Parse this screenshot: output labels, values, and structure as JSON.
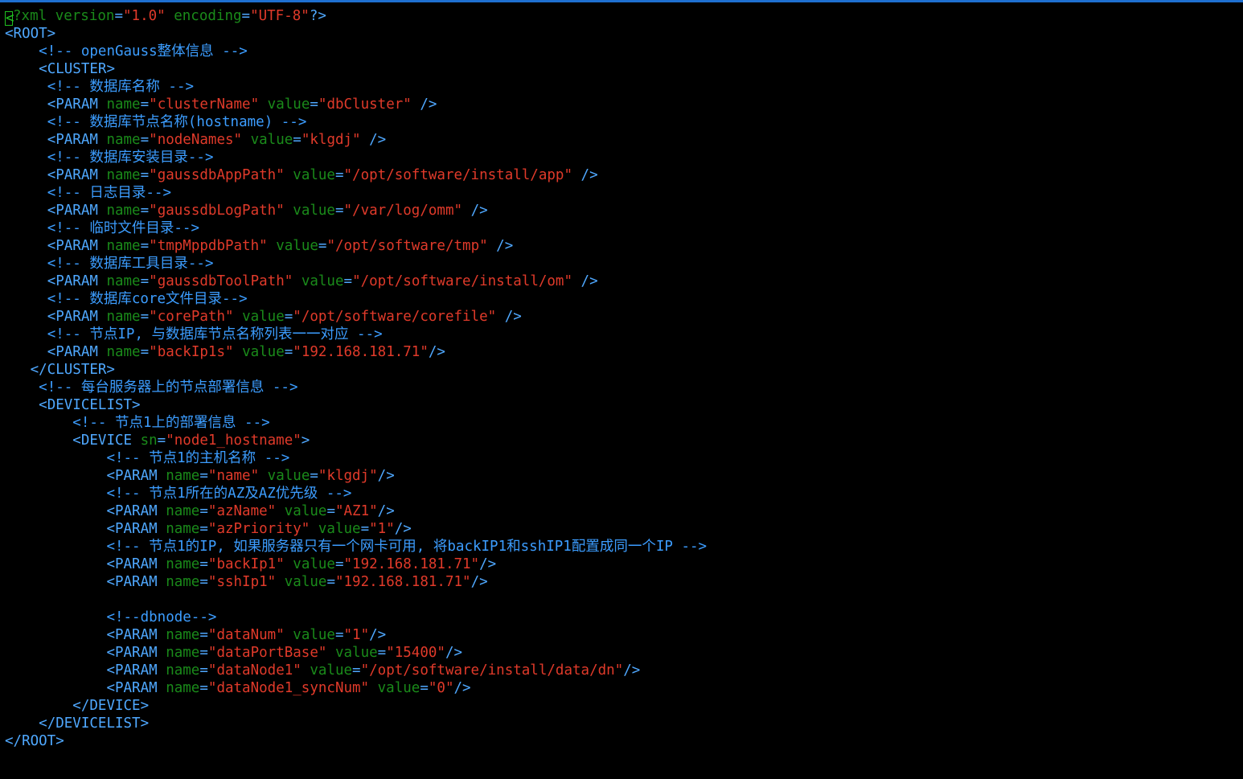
{
  "lines": [
    {
      "indent": "",
      "type": "pi"
    },
    {
      "indent": "",
      "type": "tag",
      "text": "<ROOT>"
    },
    {
      "indent": "    ",
      "type": "comment",
      "text": "<!-- openGauss整体信息 -->"
    },
    {
      "indent": "    ",
      "type": "tag",
      "text": "<CLUSTER>"
    },
    {
      "indent": "     ",
      "type": "comment",
      "text": "<!-- 数据库名称 -->"
    },
    {
      "indent": "     ",
      "type": "param",
      "name": "clusterName",
      "value": "dbCluster",
      "sep": " ",
      "close": " />"
    },
    {
      "indent": "     ",
      "type": "comment",
      "text": "<!-- 数据库节点名称(hostname) -->"
    },
    {
      "indent": "     ",
      "type": "param",
      "name": "nodeNames",
      "value": "klgdj",
      "sep": " ",
      "close": " />"
    },
    {
      "indent": "     ",
      "type": "comment",
      "text": "<!-- 数据库安装目录-->"
    },
    {
      "indent": "     ",
      "type": "param",
      "name": "gaussdbAppPath",
      "value": "/opt/software/install/app",
      "sep": " ",
      "close": " />"
    },
    {
      "indent": "     ",
      "type": "comment",
      "text": "<!-- 日志目录-->"
    },
    {
      "indent": "     ",
      "type": "param",
      "name": "gaussdbLogPath",
      "value": "/var/log/omm",
      "sep": " ",
      "close": " />"
    },
    {
      "indent": "     ",
      "type": "comment",
      "text": "<!-- 临时文件目录-->"
    },
    {
      "indent": "     ",
      "type": "param",
      "name": "tmpMppdbPath",
      "value": "/opt/software/tmp",
      "sep": " ",
      "close": " />"
    },
    {
      "indent": "     ",
      "type": "comment",
      "text": "<!-- 数据库工具目录-->"
    },
    {
      "indent": "     ",
      "type": "param",
      "name": "gaussdbToolPath",
      "value": "/opt/software/install/om",
      "sep": " ",
      "close": " />"
    },
    {
      "indent": "     ",
      "type": "comment",
      "text": "<!-- 数据库core文件目录-->"
    },
    {
      "indent": "     ",
      "type": "param",
      "name": "corePath",
      "value": "/opt/software/corefile",
      "sep": " ",
      "close": " />"
    },
    {
      "indent": "     ",
      "type": "comment",
      "text": "<!-- 节点IP, 与数据库节点名称列表一一对应 -->"
    },
    {
      "indent": "     ",
      "type": "param",
      "name": "backIp1s",
      "value": "192.168.181.71",
      "sep": " ",
      "close": "/>"
    },
    {
      "indent": "   ",
      "type": "tag",
      "text": "</CLUSTER>"
    },
    {
      "indent": "    ",
      "type": "comment",
      "text": "<!-- 每台服务器上的节点部署信息 -->"
    },
    {
      "indent": "    ",
      "type": "tag",
      "text": "<DEVICELIST>"
    },
    {
      "indent": "        ",
      "type": "comment",
      "text": "<!-- 节点1上的部署信息 -->"
    },
    {
      "indent": "        ",
      "type": "device",
      "attr": "sn",
      "value": "node1_hostname"
    },
    {
      "indent": "            ",
      "type": "comment",
      "text": "<!-- 节点1的主机名称 -->"
    },
    {
      "indent": "            ",
      "type": "param",
      "name": "name",
      "value": "klgdj",
      "sep": " ",
      "close": "/>"
    },
    {
      "indent": "            ",
      "type": "comment",
      "text": "<!-- 节点1所在的AZ及AZ优先级 -->"
    },
    {
      "indent": "            ",
      "type": "param",
      "name": "azName",
      "value": "AZ1",
      "sep": " ",
      "close": "/>"
    },
    {
      "indent": "            ",
      "type": "param",
      "name": "azPriority",
      "value": "1",
      "sep": " ",
      "close": "/>"
    },
    {
      "indent": "            ",
      "type": "comment",
      "text": "<!-- 节点1的IP, 如果服务器只有一个网卡可用, 将backIP1和sshIP1配置成同一个IP -->"
    },
    {
      "indent": "            ",
      "type": "param",
      "name": "backIp1",
      "value": "192.168.181.71",
      "sep": " ",
      "close": "/>"
    },
    {
      "indent": "            ",
      "type": "param",
      "name": "sshIp1",
      "value": "192.168.181.71",
      "sep": " ",
      "close": "/>"
    },
    {
      "indent": "",
      "type": "blank"
    },
    {
      "indent": "            ",
      "type": "comment",
      "text": "<!--dbnode-->"
    },
    {
      "indent": "            ",
      "type": "param",
      "name": "dataNum",
      "value": "1",
      "sep": " ",
      "close": "/>"
    },
    {
      "indent": "            ",
      "type": "param",
      "name": "dataPortBase",
      "value": "15400",
      "sep": " ",
      "close": "/>"
    },
    {
      "indent": "            ",
      "type": "param",
      "name": "dataNode1",
      "value": "/opt/software/install/data/dn",
      "sep": " ",
      "close": "/>"
    },
    {
      "indent": "            ",
      "type": "param",
      "name": "dataNode1_syncNum",
      "value": "0",
      "sep": " ",
      "close": "/>"
    },
    {
      "indent": "        ",
      "type": "tag",
      "text": "</DEVICE>"
    },
    {
      "indent": "    ",
      "type": "tag",
      "text": "</DEVICELIST>"
    },
    {
      "indent": "",
      "type": "tag",
      "text": "</ROOT>"
    }
  ],
  "pi": {
    "cursor_char": "<",
    "rest_open": "?xml ",
    "attr1": "version",
    "val1": "\"1.0\"",
    "attr2": "encoding",
    "val2": "\"UTF-8\"",
    "end": "?>"
  },
  "tokens": {
    "param_open": "<PARAM ",
    "name_attr": "name",
    "value_attr": "value",
    "device_open": "<DEVICE ",
    "device_close": ">",
    "eq": "="
  }
}
